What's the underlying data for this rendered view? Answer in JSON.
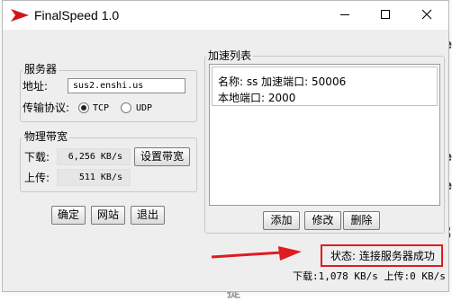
{
  "window": {
    "title": "FinalSpeed 1.0"
  },
  "server": {
    "legend": "服务器",
    "address_label": "地址:",
    "address_value": "sus2.enshi.us",
    "protocol_label": "传输协议:",
    "protocols": [
      "TCP",
      "UDP"
    ],
    "selected_protocol": "TCP"
  },
  "bandwidth": {
    "legend": "物理带宽",
    "download_label": "下载:",
    "download_value": "6,256 KB/s",
    "upload_label": "上传:",
    "upload_value": "511 KB/s",
    "set_button": "设置带宽"
  },
  "actions": {
    "ok": "确定",
    "site": "网站",
    "exit": "退出"
  },
  "accel": {
    "legend": "加速列表",
    "items": [
      {
        "line1": "名称: ss  加速端口: 50006",
        "line2": "本地端口: 2000"
      }
    ],
    "add": "添加",
    "modify": "修改",
    "delete": "删除"
  },
  "status": {
    "text": "状态: 连接服务器成功",
    "traffic": "下载:1,078 KB/s 上传:0 KB/s",
    "highlight_color": "#e01a22"
  },
  "background": {
    "fragments": [
      "e",
      "3",
      "e",
      "提"
    ]
  },
  "icons": {
    "app": "red-arrow-logo-icon",
    "minimize": "minimize-icon",
    "maximize": "maximize-icon",
    "close": "close-icon",
    "annotation": "red-arrow-icon"
  }
}
